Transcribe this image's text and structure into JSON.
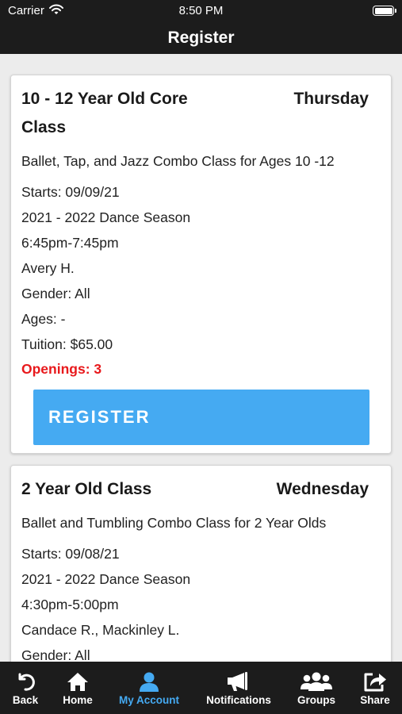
{
  "status_bar": {
    "carrier": "Carrier",
    "time": "8:50 PM",
    "battery_level": 1.0
  },
  "header": {
    "title": "Register"
  },
  "classes": [
    {
      "name": "10 - 12 Year Old Core Class",
      "day": "Thursday",
      "description": "Ballet, Tap, and Jazz Combo Class for Ages 10 -12",
      "starts": "Starts: 09/09/21",
      "season": "2021 - 2022 Dance Season",
      "time": "6:45pm-7:45pm",
      "instructor": "Avery H.",
      "gender": "Gender: All",
      "ages": "Ages: -",
      "tuition": "Tuition: $65.00",
      "openings": "Openings: 3",
      "button": "REGISTER"
    },
    {
      "name": "2 Year Old Class",
      "day": "Wednesday",
      "description": "Ballet and Tumbling Combo Class for 2 Year Olds",
      "starts": "Starts: 09/08/21",
      "season": "2021 - 2022 Dance Season",
      "time": "4:30pm-5:00pm",
      "instructor": "Candace R., Mackinley L.",
      "gender": "Gender: All"
    }
  ],
  "tabs": [
    {
      "label": "Back",
      "icon": "back-arrow-icon"
    },
    {
      "label": "Home",
      "icon": "home-icon"
    },
    {
      "label": "My Account",
      "icon": "user-icon",
      "active": true
    },
    {
      "label": "Notifications",
      "icon": "megaphone-icon"
    },
    {
      "label": "Groups",
      "icon": "group-icon"
    },
    {
      "label": "Share",
      "icon": "share-icon"
    }
  ],
  "colors": {
    "header_bg": "#1c1c1c",
    "accent": "#45aaf2",
    "openings": "#e8191c",
    "page_bg": "#ececec"
  }
}
